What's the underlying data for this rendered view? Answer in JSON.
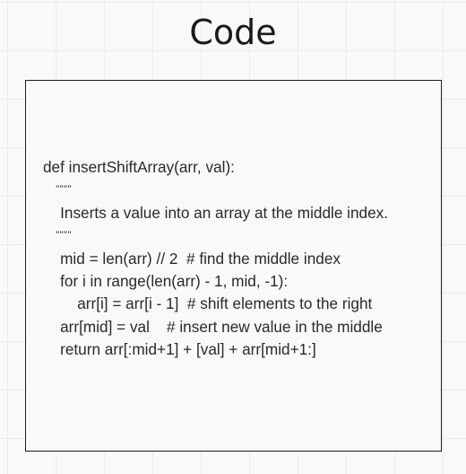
{
  "diagram": {
    "title": "Code",
    "code_lines": [
      "def insertShiftArray(arr, val):",
      "    \"\"\"\"",
      "    Inserts a value into an array at the middle index.",
      "    \"\"\"\"",
      "    mid = len(arr) // 2  # find the middle index",
      "    for i in range(len(arr) - 1, mid, -1):",
      "        arr[i] = arr[i - 1]  # shift elements to the right",
      "    arr[mid] = val    # insert new value in the middle",
      "    return arr[:mid+1] + [val] + arr[mid+1:]"
    ]
  }
}
